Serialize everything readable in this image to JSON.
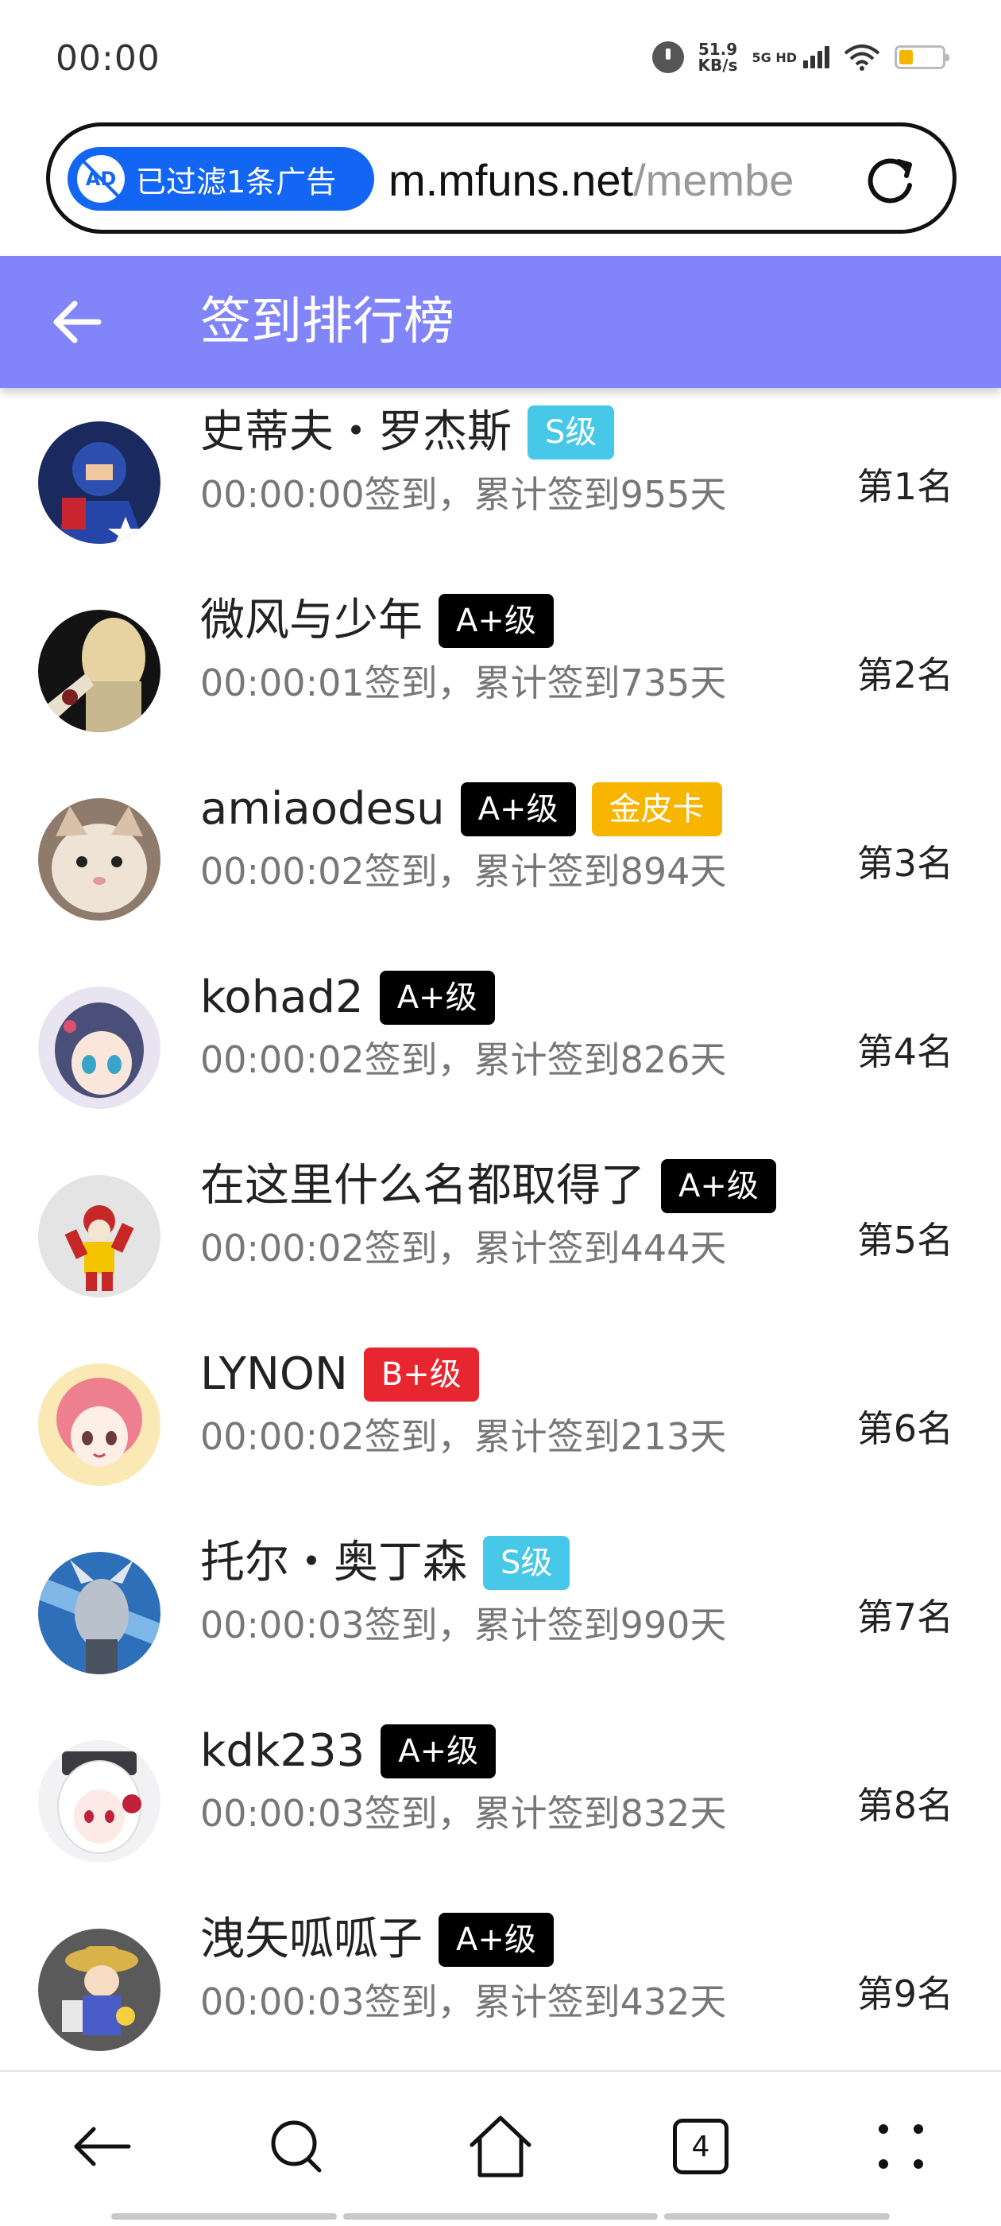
{
  "status_bar": {
    "time": "00:00",
    "net_speed_value": "51.9",
    "net_speed_unit": "KB/s",
    "network_type": "5G HD",
    "battery_level": 0.3,
    "battery_color": "#f5b400"
  },
  "address_bar": {
    "ad_filter_text": "已过滤1条广告",
    "ad_icon_text": "AD",
    "url_host": "m.mfuns.net",
    "url_path": "/membe",
    "accent_color": "#1366f3"
  },
  "header": {
    "title": "签到排行榜",
    "background_color": "#8285f9"
  },
  "badge_colors": {
    "S级": "#48c8e8",
    "A+级": "#000000",
    "B+级": "#e8262f",
    "金皮卡": "#f7b500"
  },
  "ranking": [
    {
      "name": "史蒂夫・罗杰斯",
      "badges": [
        "S级"
      ],
      "meta": "00:00:00签到，累计签到955天",
      "rank": "第1名",
      "avatar": "captain-america-avatar"
    },
    {
      "name": "微风与少年",
      "badges": [
        "A+级"
      ],
      "meta": "00:00:01签到，累计签到735天",
      "rank": "第2名",
      "avatar": "anime-character-avatar"
    },
    {
      "name": "amiaodesu",
      "badges": [
        "A+级",
        "金皮卡"
      ],
      "meta": "00:00:02签到，累计签到894天",
      "rank": "第3名",
      "avatar": "cat-avatar"
    },
    {
      "name": "kohad2",
      "badges": [
        "A+级"
      ],
      "meta": "00:00:02签到，累计签到826天",
      "rank": "第4名",
      "avatar": "anime-girl-avatar"
    },
    {
      "name": "在这里什么名都取得了",
      "badges": [
        "A+级"
      ],
      "meta": "00:00:02签到，累计签到444天",
      "rank": "第5名",
      "avatar": "clown-avatar"
    },
    {
      "name": "LYNON",
      "badges": [
        "B+级"
      ],
      "meta": "00:00:02签到，累计签到213天",
      "rank": "第6名",
      "avatar": "pink-hair-girl-avatar"
    },
    {
      "name": "托尔・奥丁森",
      "badges": [
        "S级"
      ],
      "meta": "00:00:03签到，累计签到990天",
      "rank": "第7名",
      "avatar": "thor-avatar"
    },
    {
      "name": "kdk233",
      "badges": [
        "A+级"
      ],
      "meta": "00:00:03签到，累计签到832天",
      "rank": "第8名",
      "avatar": "white-hair-girl-avatar"
    },
    {
      "name": "洩矢呱呱子",
      "badges": [
        "A+级"
      ],
      "meta": "00:00:03签到，累计签到432天",
      "rank": "第9名",
      "avatar": "suwako-figure-avatar"
    }
  ],
  "bottom_nav": {
    "tab_count": "4"
  }
}
